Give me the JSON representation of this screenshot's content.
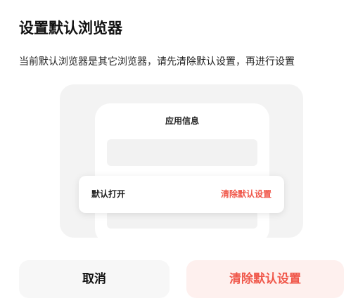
{
  "dialog": {
    "title": "设置默认浏览器",
    "description": "当前默认浏览器是其它浏览器，请先清除默认设置，再进行设置"
  },
  "illustration": {
    "phone_title": "应用信息",
    "popup_left_label": "默认打开",
    "popup_right_label": "清除默认设置"
  },
  "buttons": {
    "cancel_label": "取消",
    "clear_label": "清除默认设置"
  },
  "colors": {
    "accent": "#f0574a",
    "accent_bg": "#fef0ee",
    "illustration_bg": "#f3f3f3"
  }
}
